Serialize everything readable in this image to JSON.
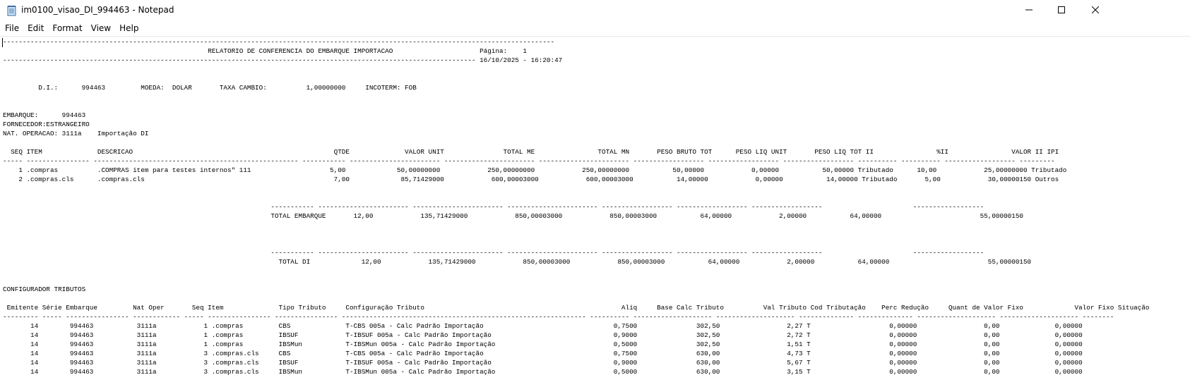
{
  "window": {
    "title": "im0100_visao_DI_994463 - Notepad",
    "app_icon": "notepad-icon",
    "controls": [
      "minimize-icon",
      "maximize-icon",
      "close-icon"
    ]
  },
  "menu": [
    "File",
    "Edit",
    "Format",
    "View",
    "Help"
  ],
  "document": {
    "lines": [
      "--------------------------------------------------------------------------------------------------------------------------------------------",
      "                                                    RELATORIO DE CONFERENCIA DO EMBARQUE IMPORTACAO                      Página:    1",
      "------------------------------------------------------------------------------------------------------------------------ 16/10/2025 - 16:20:47",
      "",
      "",
      "         D.I.:      994463         MOEDA:  DOLAR       TAXA CAMBIO:          1,00000000     INCOTERM: FOB",
      "",
      "",
      "EMBARQUE:      994463",
      "FORNECEDOR:ESTRANGEIRO",
      "NAT. OPERACAO: 3111a    Importação DI",
      "",
      "  SEQ ITEM              DESCRICAO                                                   QTDE              VALOR UNIT               TOTAL ME                TOTAL MN       PESO BRUTO TOT      PESO LIQ UNIT       PESO LIQ TOT II                %II                VALOR II IPI",
      "----- ---------------- ---------------------------------------------------- ----------- ----------------------- ----------------------- ----------------------- ------------------ ------------------ ------------------ ---------- ---------- ------------------ ---------",
      "    1 .compras          .COMPRAS item para testes internos\" 111                    5,00             50,00000000            250,00000000            250,00000000           50,00000            0,00000           50,00000 Tributado      10,00            25,00000000 Tributado",
      "    2 .compras.cls      .compras.cls                                                7,00             85,71429000            600,00003000            600,00003000           14,00000            0,00000           14,00000 Tributado       5,00            30,00000150 Outros",
      "",
      "",
      "                                                                    ----------- ----------------------- ----------------------- ----------------------- ------------------ ------------------ ------------------                       ------------------",
      "                                                                    TOTAL EMBARQUE       12,00            135,71429000            850,00003000            850,00003000           64,00000            2,00000           64,00000                         55,00000150",
      "",
      "",
      "",
      "                                                                    ----------- ----------------------- ----------------------- ----------------------- ------------------ ------------------ ------------------                       ------------------",
      "                                                                      TOTAL DI             12,00            135,71429000            850,00003000            850,00003000           64,00000            2,00000           64,00000                         55,00000150",
      "",
      "",
      "CONFIGURADOR TRIBUTOS",
      "",
      " Emitente Série Embarque         Nat Oper       Seq Item              Tipo Tributo     Configuração Tributo                                                  Aliq     Base Calc Tributo          Val Tributo Cod Tributação    Perc Redução     Quant de Valor Fixo             Valor Fixo Situação",
      "--------- ----- ---------------- ------------ ----- ---------------- ---------------- -------------------------------------------------------------- ---------- -------------------- -------------------- -------------- -------------- -------------------- -------------------- --------",
      "       14        994463           3111a            1 .compras         CBS              T-CBS 005a - Calc Padrão Importação                                 0,7500               302,50                 2,27 T                    0,00000                 0,00              0,00000",
      "       14        994463           3111a            1 .compras         IBSUF            T-IBSUF 005a - Calc Padrão Importação                               0,9000               302,50                 2,72 T                    0,00000                 0,00              0,00000",
      "       14        994463           3111a            1 .compras         IBSMun           T-IBSMun 005a - Calc Padrão Importação                              0,5000               302,50                 1,51 T                    0,00000                 0,00              0,00000",
      "       14        994463           3111a            3 .compras.cls     CBS              T-CBS 005a - Calc Padrão Importação                                 0,7500               630,00                 4,73 T                    0,00000                 0,00              0,00000",
      "       14        994463           3111a            3 .compras.cls     IBSUF            T-IBSUF 005a - Calc Padrão Importação                               0,9000               630,00                 5,67 T                    0,00000                 0,00              0,00000",
      "       14        994463           3111a            3 .compras.cls     IBSMun           T-IBSMun 005a - Calc Padrão Importação                              0,5000               630,00                 3,15 T                    0,00000                 0,00              0,00000"
    ]
  }
}
